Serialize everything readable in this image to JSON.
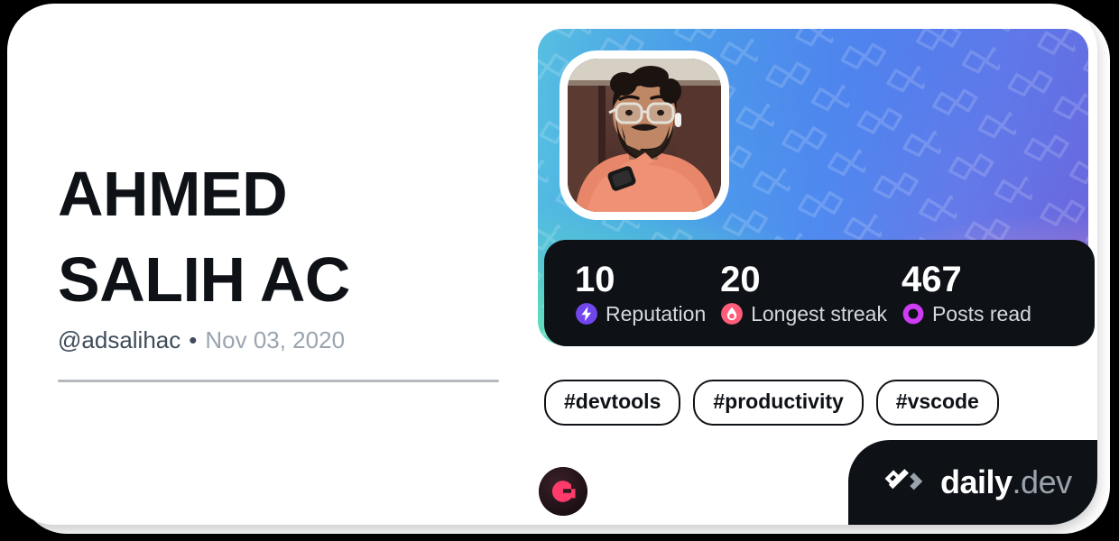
{
  "card": {
    "profile": {
      "display_name": "AHMED\nSALIH AC",
      "handle": "@adsalihac",
      "separator": "•",
      "joined_date": "Nov 03, 2020",
      "avatar_alt": "profile-photo"
    },
    "stats": [
      {
        "value": "10",
        "label": "Reputation",
        "icon": "reputation-bolt-icon",
        "color": "#7147ED"
      },
      {
        "value": "20",
        "label": "Longest streak",
        "icon": "streak-flame-icon",
        "color": "#FF5C7A"
      },
      {
        "value": "467",
        "label": "Posts read",
        "icon": "posts-read-ring-icon",
        "color": "#CE3DF3"
      }
    ],
    "tags": [
      {
        "label": "#devtools"
      },
      {
        "label": "#productivity"
      },
      {
        "label": "#vscode"
      }
    ],
    "source_badge": {
      "icon": "source-logo-icon",
      "color": "#FF3B6B"
    },
    "brand": {
      "mark": "daily-dev-logo-icon",
      "name": "daily",
      "suffix": ".dev"
    },
    "theme": {
      "card_background": "#FFFFFF",
      "text_primary": "#0E1217",
      "text_muted": "#9AA4B0",
      "stats_bar_background": "#0E1217",
      "cover_gradient_start": "#57C2E0",
      "cover_gradient_end": "#6E5FD8"
    }
  }
}
